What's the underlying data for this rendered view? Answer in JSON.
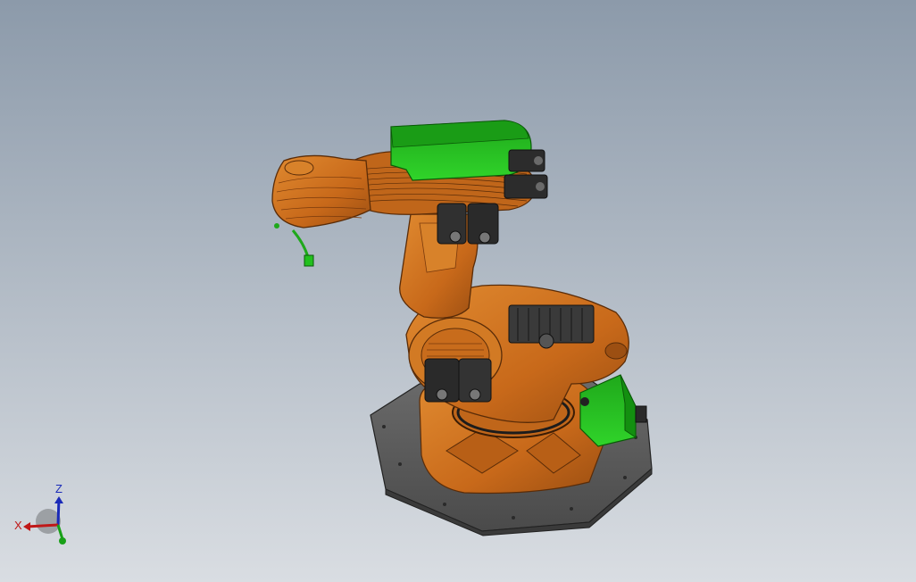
{
  "viewport": {
    "background_top": "#8c9aaa",
    "background_bottom": "#d9dde2"
  },
  "model": {
    "orange": "#d2741c",
    "orange_dark": "#8a4510",
    "green": "#22c01e",
    "green_dark": "#0f7a0c",
    "grey": "#5d5d5d",
    "grey_dark": "#303030",
    "black": "#1c1c1c"
  },
  "triad": {
    "x_label": "X",
    "z_label": "Z",
    "x_color": "#c01818",
    "z_color": "#1a2ab8",
    "y_color": "#18a018"
  }
}
